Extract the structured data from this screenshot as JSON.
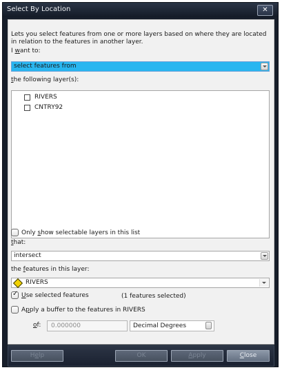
{
  "window": {
    "title": "Select By Location",
    "close_glyph": "✕"
  },
  "description": "Lets you select features from one or more layers based on where they are located in relation to the features in another layer.",
  "method": {
    "label_pre": "I ",
    "label_key": "w",
    "label_post": "ant to:",
    "value": "select features from"
  },
  "target_layers": {
    "label_key": "t",
    "label_post": "he following layer(s):",
    "items": [
      {
        "label": "RIVERS",
        "checked": false
      },
      {
        "label": "CNTRY92",
        "checked": false
      }
    ]
  },
  "selectable_only": {
    "pre": "Only ",
    "key": "s",
    "post": "how selectable layers in this list",
    "checked": false
  },
  "relationship": {
    "label_key": "t",
    "label_post": "hat:",
    "value": "intersect"
  },
  "source_layer": {
    "label_pre": "the ",
    "label_key": "f",
    "label_post": "eatures in this layer:",
    "value": "RIVERS",
    "icon": "diamond-layer-icon"
  },
  "use_selected": {
    "key": "U",
    "post": "se selected features",
    "checked": true,
    "count_text": "(1 features selected)"
  },
  "buffer": {
    "pre": "A",
    "key": "p",
    "post": "ply a buffer to the features in RIVERS",
    "checked": false,
    "of_key": "o",
    "of_post": "f:",
    "value": "0.000000",
    "units": "Decimal Degrees"
  },
  "buttons": {
    "help_pre": "H",
    "help_key": "e",
    "help_post": "lp",
    "ok": "OK",
    "apply_key": "A",
    "apply_post": "pply",
    "close_key": "C",
    "close_post": "lose"
  },
  "colors": {
    "selection": "#29b6f0",
    "title_bar": "#1e2634",
    "footer": "#232b3a"
  }
}
